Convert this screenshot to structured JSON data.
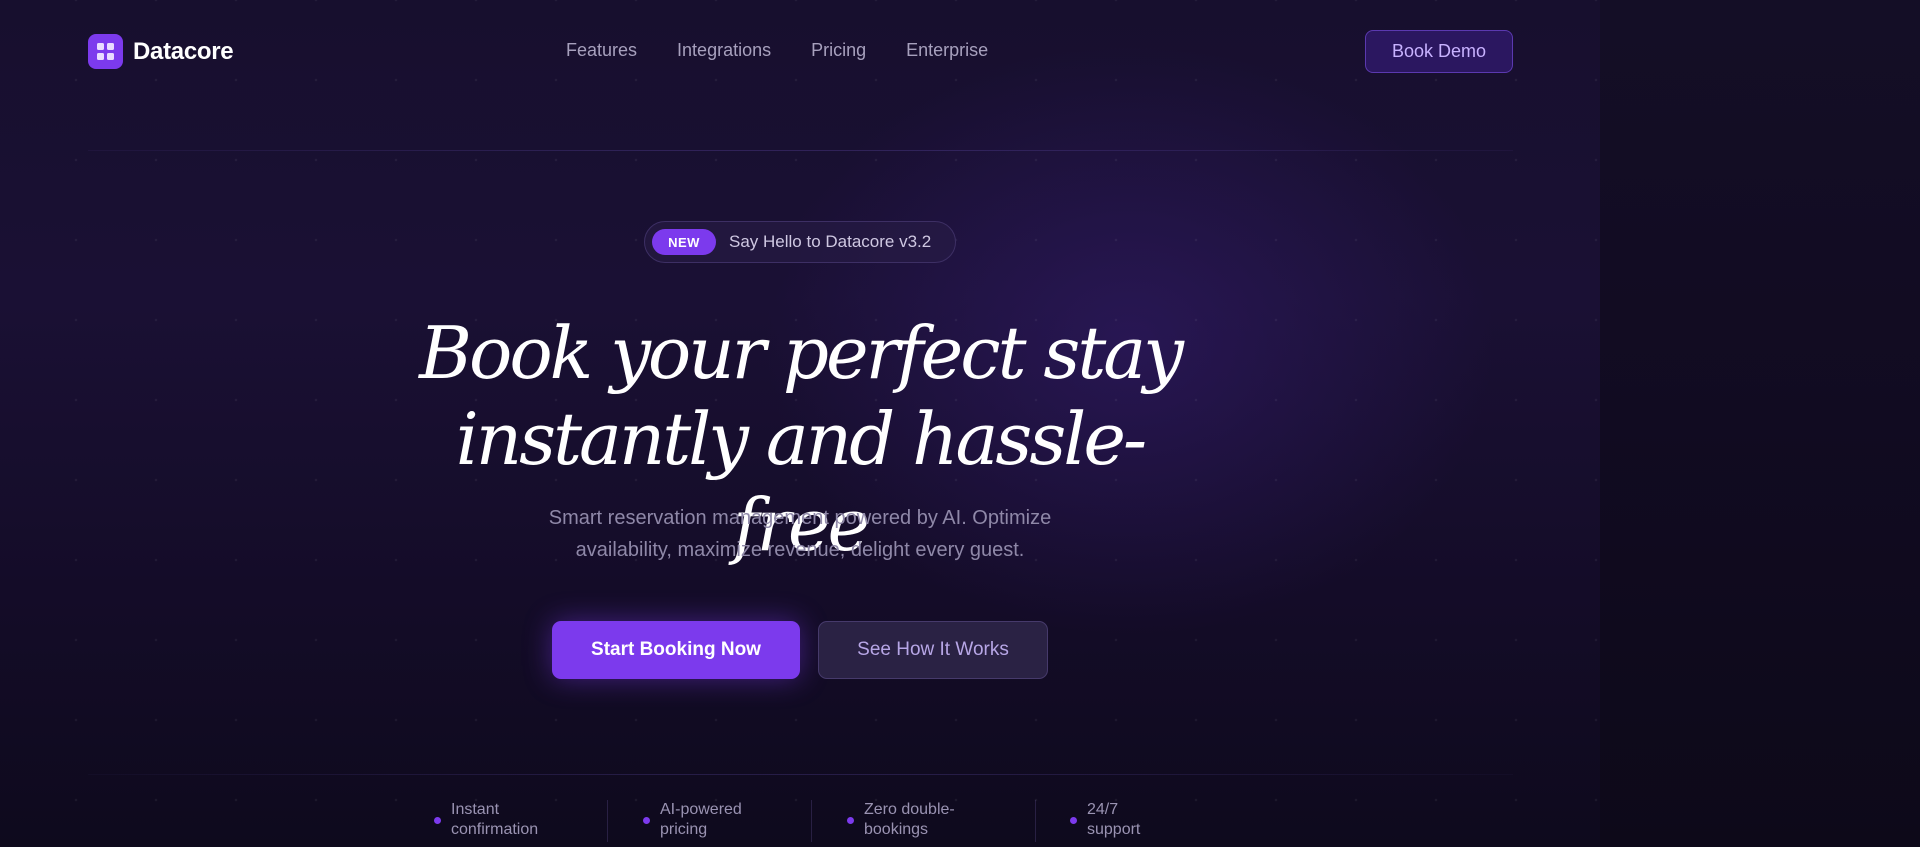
{
  "brand": {
    "name": "Datacore",
    "accent": "#7c3aed"
  },
  "nav": {
    "items": [
      {
        "label": "Features"
      },
      {
        "label": "Integrations"
      },
      {
        "label": "Pricing"
      },
      {
        "label": "Enterprise"
      }
    ],
    "cta_label": "Book Demo"
  },
  "hero": {
    "badge_label": "NEW",
    "badge_text": "Say Hello to Datacore v3.2",
    "headline_line1": "Book your perfect stay",
    "headline_line2": "instantly and hassle-free",
    "subtitle_line1": "Smart reservation management powered by AI. Optimize",
    "subtitle_line2": "availability, maximize revenue, delight every guest.",
    "primary_cta": "Start Booking Now",
    "secondary_cta": "See How It Works"
  },
  "features": [
    {
      "line1": "Instant",
      "line2": "confirmation"
    },
    {
      "line1": "AI-powered",
      "line2": "pricing"
    },
    {
      "line1": "Zero double-",
      "line2": "bookings"
    },
    {
      "line1": "24/7",
      "line2": "support"
    }
  ]
}
